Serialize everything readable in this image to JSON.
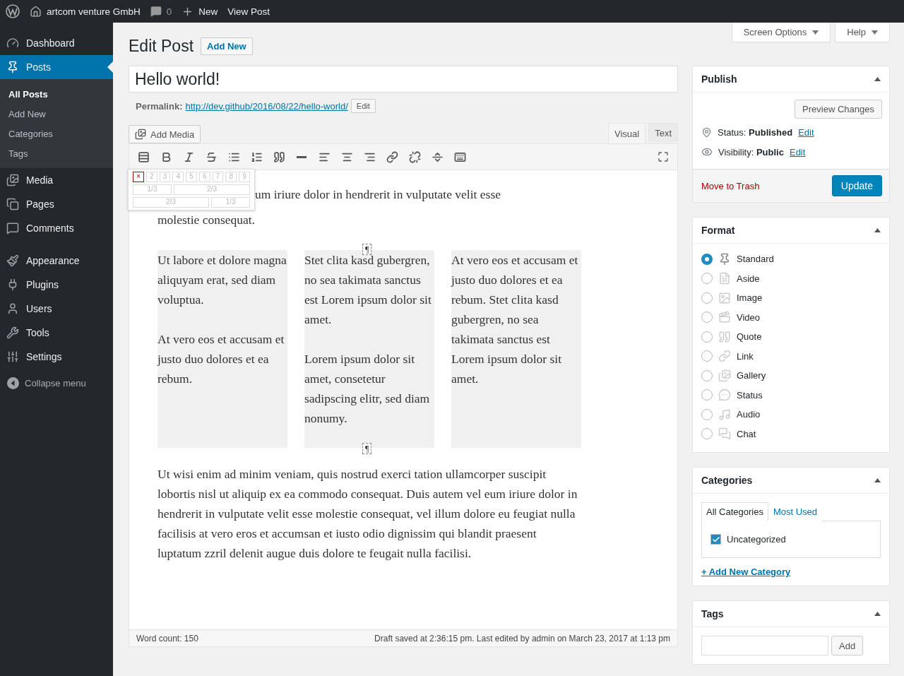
{
  "admin_bar": {
    "site": "artcom venture GmbH",
    "comments": "0",
    "new": "New",
    "view": "View Post"
  },
  "menu": [
    [
      {
        "label": "Dashboard",
        "selected": false
      },
      {
        "label": "Posts",
        "selected": true,
        "children": [
          {
            "label": "All Posts",
            "selected": true
          },
          {
            "label": "Add New",
            "selected": false
          },
          {
            "label": "Categories",
            "selected": false
          },
          {
            "label": "Tags",
            "selected": false
          }
        ]
      },
      {
        "label": "Media",
        "selected": false
      },
      {
        "label": "Pages",
        "selected": false
      },
      {
        "label": "Comments",
        "selected": false
      }
    ],
    [
      {
        "label": "Appearance",
        "selected": false
      },
      {
        "label": "Plugins",
        "selected": false
      },
      {
        "label": "Users",
        "selected": false
      },
      {
        "label": "Tools",
        "selected": false
      },
      {
        "label": "Settings",
        "selected": false
      }
    ]
  ],
  "collapse": "Collapse menu",
  "screen_buttons": [
    "Screen Options",
    "Help"
  ],
  "heading": "Edit Post",
  "add_new": "Add New",
  "post_title": "Hello world!",
  "permalink": {
    "label": "Permalink:",
    "url": "http://dev.github/2016/08/22/hello-world/",
    "edit": "Edit"
  },
  "add_media": "Add Media",
  "editor_tabs": [
    {
      "label": "Visual",
      "selected": true
    },
    {
      "label": "Text",
      "selected": false
    }
  ],
  "column_picker": {
    "counts": [
      {
        "label": "×",
        "selected": true
      },
      {
        "label": "2",
        "selected": false
      },
      {
        "label": "3",
        "selected": false
      },
      {
        "label": "4",
        "selected": false
      },
      {
        "label": "5",
        "selected": false
      },
      {
        "label": "6",
        "selected": false
      },
      {
        "label": "7",
        "selected": false
      },
      {
        "label": "8",
        "selected": false
      },
      {
        "label": "9",
        "selected": false
      }
    ],
    "layouts": [
      [
        "1/3",
        "2/3"
      ],
      [
        "2/3",
        "1/3"
      ]
    ]
  },
  "content": {
    "intro": [
      "um iriure dolor in hendrerit in vulputate velit esse",
      "molestie consequat."
    ],
    "columns": [
      {
        "paragraphs": [
          "Ut labore et dolore magna aliquyam erat, sed diam voluptua.",
          "At vero eos et accusam et justo duo dolores et ea rebum."
        ]
      },
      {
        "paragraphs": [
          "Stet clita kasd gubergren, no sea takimata sanctus est Lorem ipsum dolor sit amet.",
          "Lorem ipsum dolor sit amet, consetetur sadipscing elitr, sed diam nonumy."
        ],
        "marks": [
          "¶",
          "¶"
        ]
      },
      {
        "paragraphs": [
          "At vero eos et accusam et justo duo dolores et ea rebum. Stet clita kasd gubergren, no sea takimata sanctus est Lorem ipsum dolor sit amet."
        ]
      }
    ],
    "paragraph": "Ut wisi enim ad minim veniam, quis nostrud exerci tation ullamcorper suscipit lobortis nisl ut aliquip ex ea commodo consequat. Duis autem vel eum iriure dolor in hendrerit in vulputate velit esse molestie consequat, vel illum dolore eu feugiat nulla facilisis at vero eros et accumsan et iusto odio dignissim qui blandit praesent luptatum zzril delenit augue duis dolore te feugait nulla facilisi."
  },
  "word_count": "Word count: 150",
  "draft_status": "Draft saved at 2:36:15 pm. Last edited by admin on March 23, 2017 at 1:13 pm",
  "publish": {
    "title": "Publish",
    "preview": "Preview Changes",
    "status": "Status: **Published**",
    "status_edit": "Edit",
    "visibility": "Visibility: **Public**",
    "visibility_edit": "Edit",
    "trash": "Move to Trash",
    "update": "Update"
  },
  "format": {
    "title": "Format",
    "options": [
      {
        "label": "Standard",
        "selected": true
      },
      {
        "label": "Aside",
        "selected": false
      },
      {
        "label": "Image",
        "selected": false
      },
      {
        "label": "Video",
        "selected": false
      },
      {
        "label": "Quote",
        "selected": false
      },
      {
        "label": "Link",
        "selected": false
      },
      {
        "label": "Gallery",
        "selected": false
      },
      {
        "label": "Status",
        "selected": false
      },
      {
        "label": "Audio",
        "selected": false
      },
      {
        "label": "Chat",
        "selected": false
      }
    ]
  },
  "categories": {
    "title": "Categories",
    "tabs": [
      {
        "label": "All Categories",
        "selected": true
      },
      {
        "label": "Most Used",
        "selected": false
      }
    ],
    "items": [
      {
        "label": "Uncategorized",
        "checked": true
      }
    ],
    "add_link": "+ Add New Category"
  },
  "tags": {
    "title": "Tags",
    "button": "Add"
  }
}
